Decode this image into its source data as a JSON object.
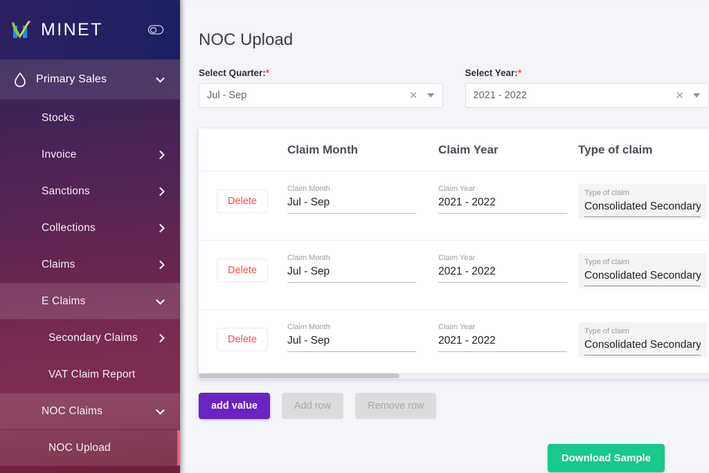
{
  "sidebar": {
    "brand": "MINET",
    "toggle_icon": "toggle-switch-icon",
    "logo_icon": "minet-logo-icon",
    "group": {
      "label": "Primary Sales",
      "icon": "droplet-icon",
      "chevron": "chevron-down-icon"
    },
    "items": [
      {
        "label": "Stocks",
        "chevron": "",
        "state": ""
      },
      {
        "label": "Invoice",
        "chevron": "right",
        "state": ""
      },
      {
        "label": "Sanctions",
        "chevron": "right",
        "state": ""
      },
      {
        "label": "Collections",
        "chevron": "right",
        "state": ""
      },
      {
        "label": "Claims",
        "chevron": "right",
        "state": ""
      },
      {
        "label": "E Claims",
        "chevron": "down",
        "state": "expanded"
      },
      {
        "label": "Secondary Claims",
        "chevron": "right",
        "state": "sub"
      },
      {
        "label": "VAT Claim Report",
        "chevron": "",
        "state": "sub"
      },
      {
        "label": "NOC Claims",
        "chevron": "down",
        "state": "expanded"
      },
      {
        "label": "NOC Upload",
        "chevron": "",
        "state": "active sub"
      }
    ]
  },
  "page": {
    "title": "NOC Upload"
  },
  "filters": {
    "quarter": {
      "label": "Select Quarter:",
      "required_mark": "*",
      "value": "Jul - Sep",
      "clear_icon": "close-icon",
      "caret_icon": "chevron-down-icon"
    },
    "year": {
      "label": "Select Year:",
      "required_mark": "*",
      "value": "2021 - 2022",
      "clear_icon": "close-icon",
      "caret_icon": "chevron-down-icon"
    }
  },
  "table": {
    "headers": {
      "delete": "",
      "claim_month": "Claim Month",
      "claim_year": "Claim Year",
      "type_of_claim": "Type of claim"
    },
    "rows": [
      {
        "delete_label": "Delete",
        "month_sub": "Claim Month",
        "month_value": "Jul - Sep",
        "year_sub": "Claim Year",
        "year_value": "2021 - 2022",
        "type_sub": "Type of claim",
        "type_value": "Consolidated Secondary",
        "type_ellipsis": "…"
      },
      {
        "delete_label": "Delete",
        "month_sub": "Claim Month",
        "month_value": "Jul - Sep",
        "year_sub": "Claim Year",
        "year_value": "2021 - 2022",
        "type_sub": "Type of claim",
        "type_value": "Consolidated Secondary",
        "type_ellipsis": "…"
      },
      {
        "delete_label": "Delete",
        "month_sub": "Claim Month",
        "month_value": "Jul - Sep",
        "year_sub": "Claim Year",
        "year_value": "2021 - 2022",
        "type_sub": "Type of claim",
        "type_value": "Consolidated Secondary",
        "type_ellipsis": "…"
      }
    ]
  },
  "actions": {
    "add_value": "add value",
    "add_row": "Add row",
    "remove_row": "Remove row",
    "download_sample": "Download Sample"
  },
  "colors": {
    "primary": "#6a24c4",
    "success": "#17c98a",
    "danger": "#ff4a4a",
    "accent_bar": "#ff5a6e",
    "sidebar_top": "#2d2063",
    "sidebar_bottom": "#6d1f3b",
    "page_bg": "#f4f5f9"
  }
}
